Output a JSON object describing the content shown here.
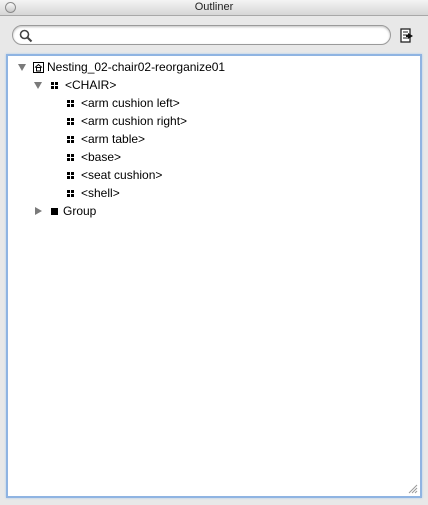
{
  "window": {
    "title": "Outliner"
  },
  "search": {
    "value": "",
    "placeholder": ""
  },
  "tree": {
    "root": {
      "label": "Nesting_02-chair02-reorganize01",
      "icon": "home-icon",
      "expanded": true
    },
    "chair": {
      "label": "<CHAIR>",
      "icon": "component-icon",
      "expanded": true
    },
    "children": [
      {
        "label": "<arm cushion left>",
        "icon": "component-icon"
      },
      {
        "label": "<arm cushion right>",
        "icon": "component-icon"
      },
      {
        "label": "<arm table>",
        "icon": "component-icon"
      },
      {
        "label": "<base>",
        "icon": "component-icon"
      },
      {
        "label": "<seat cushion>",
        "icon": "component-icon"
      },
      {
        "label": "<shell>",
        "icon": "component-icon"
      }
    ],
    "group": {
      "label": "Group",
      "icon": "group-icon",
      "expanded": false
    }
  },
  "colors": {
    "focus_ring": "#8fb4e2",
    "disclosure": "#7a7a7a"
  }
}
